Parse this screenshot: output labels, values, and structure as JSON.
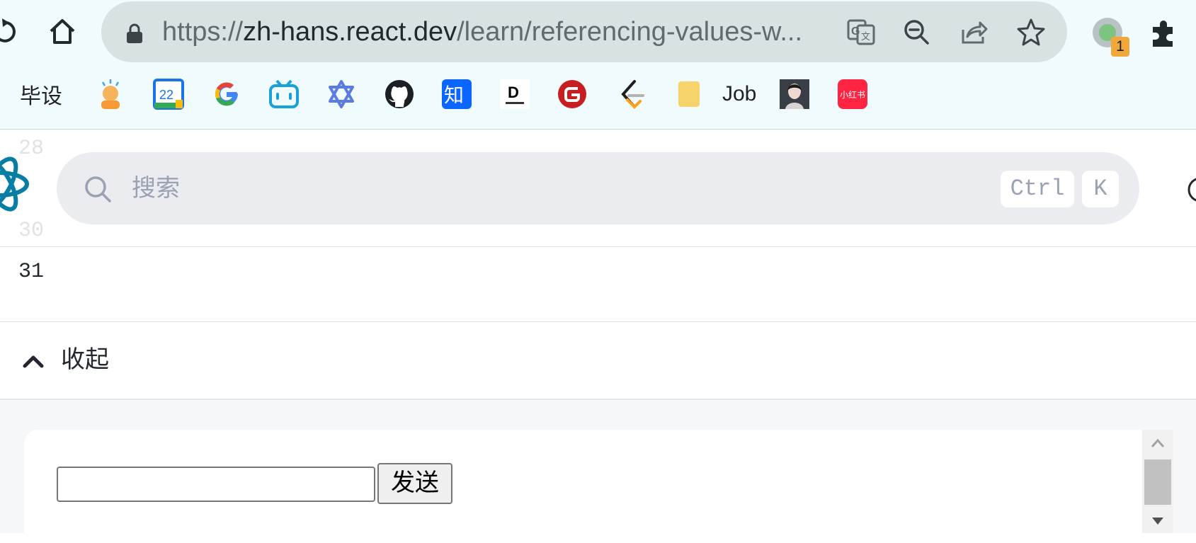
{
  "browser": {
    "url_prefix": "https://",
    "url_host": "zh-hans.react.dev",
    "url_path": "/learn/referencing-values-w...",
    "extension_badge": "1",
    "icons": [
      "reload-icon",
      "home-icon",
      "lock-icon",
      "translate-icon",
      "zoom-out-icon",
      "share-icon",
      "star-icon",
      "profile-icon",
      "extensions-icon"
    ]
  },
  "bookmarks": [
    {
      "label": "毕设",
      "icon": "folder-icon"
    },
    {
      "label": "",
      "icon": "avatar-emoji-icon"
    },
    {
      "label": "",
      "icon": "calendar-icon",
      "text": "22"
    },
    {
      "label": "",
      "icon": "google-icon"
    },
    {
      "label": "",
      "icon": "bilibili-icon"
    },
    {
      "label": "",
      "icon": "star-of-david-app-icon"
    },
    {
      "label": "",
      "icon": "github-icon"
    },
    {
      "label": "",
      "icon": "zhihu-icon",
      "text": "知"
    },
    {
      "label": "",
      "icon": "code-note-icon",
      "text": "D"
    },
    {
      "label": "",
      "icon": "gitee-icon"
    },
    {
      "label": "",
      "icon": "leetcode-icon"
    },
    {
      "label": "Job",
      "icon": "folder-icon"
    },
    {
      "label": "",
      "icon": "portrait-icon"
    },
    {
      "label": "",
      "icon": "xiaohongshu-icon",
      "text": "小红书"
    }
  ],
  "page": {
    "ghost_line_top": "28",
    "ghost_line_bottom": "30",
    "search_placeholder": "搜索",
    "shortcut_ctrl": "Ctrl",
    "shortcut_k": "K",
    "console_line_number": "31",
    "collapse_label": "收起",
    "send_button": "发送",
    "input_value": ""
  },
  "colors": {
    "chrome_bg": "#effbfc",
    "omnibox_bg": "#d8e2e3",
    "search_bg": "#ebecf0",
    "react_blue": "#087ea4",
    "preview_bg": "#f6f7f9"
  }
}
